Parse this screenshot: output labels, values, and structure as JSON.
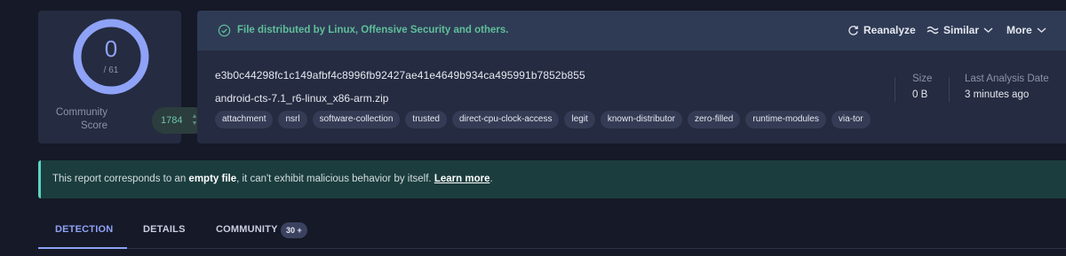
{
  "score": {
    "detections": "0",
    "total": "/ 61",
    "community_label": "Community Score",
    "community_score": "1784",
    "gauge_color": "#8ea2f7"
  },
  "header": {
    "distribution": "File distributed by Linux, Offensive Security and others.",
    "actions": {
      "reanalyze": "Reanalyze",
      "similar": "Similar",
      "more": "More"
    }
  },
  "file": {
    "hash": "e3b0c44298fc1c149afbf4c8996fb92427ae41e4649b934ca495991b7852b855",
    "name": "android-cts-7.1_r6-linux_x86-arm.zip",
    "tags": [
      "attachment",
      "nsrl",
      "software-collection",
      "trusted",
      "direct-cpu-clock-access",
      "legit",
      "known-distributor",
      "zero-filled",
      "runtime-modules",
      "via-tor"
    ],
    "size_label": "Size",
    "size_value": "0 B",
    "last_analysis_label": "Last Analysis Date",
    "last_analysis_value": "3 minutes ago"
  },
  "banner": {
    "prefix": "This report corresponds to an ",
    "emphasis": "empty file",
    "middle": ", it can't exhibit malicious behavior by itself. ",
    "link": "Learn more",
    "suffix": "."
  },
  "tabs": {
    "detection": "DETECTION",
    "details": "DETAILS",
    "community": "COMMUNITY",
    "community_count": "30 +"
  },
  "colors": {
    "accent": "#8ea2f7",
    "success": "#5fbf9a",
    "banner_border": "#5bd4c0"
  }
}
